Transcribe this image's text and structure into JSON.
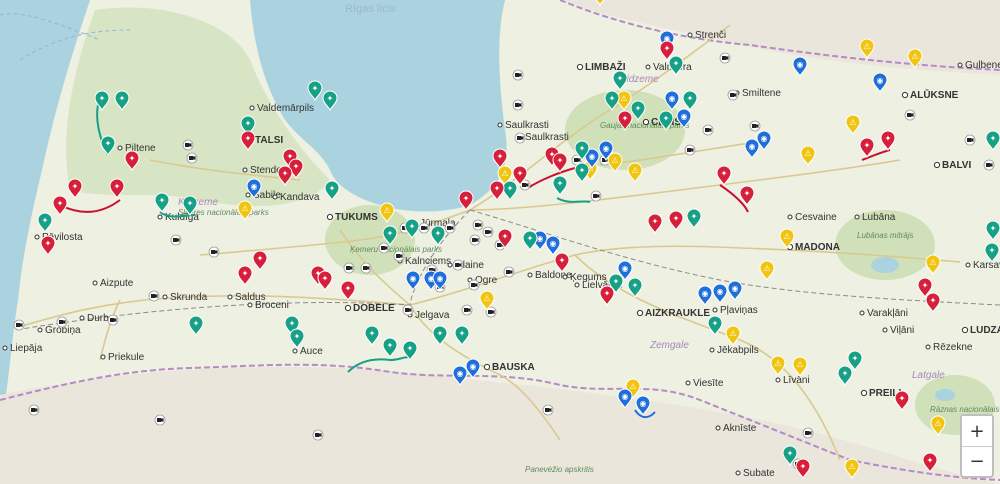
{
  "map": {
    "sea_label": "Rīgas līcis",
    "region_labels": [
      "Kurzeme",
      "Vidzeme",
      "Zemgale",
      "Latgale"
    ],
    "park_labels": [
      "Gaujas nacionālais parks",
      "Ķemeru nacionālais parks",
      "Lubānas mitrājs",
      "Rāznas nacionālais parks",
      "Slīteres nacionālais parks"
    ],
    "neighbor_labels": [
      "Panevėžio apskritis"
    ],
    "places": [
      {
        "name": "LIMBAŽI",
        "major": true
      },
      {
        "name": "Valmiera",
        "major": false
      },
      {
        "name": "Strenči",
        "major": false
      },
      {
        "name": "Smiltene",
        "major": false
      },
      {
        "name": "ALŪKSNE",
        "major": true
      },
      {
        "name": "Valdemārpils",
        "major": false
      },
      {
        "name": "TALSI",
        "major": true
      },
      {
        "name": "Saulkrasti",
        "major": false
      },
      {
        "name": "CĒSIS",
        "major": true
      },
      {
        "name": "Piltene",
        "major": false
      },
      {
        "name": "Stende",
        "major": false
      },
      {
        "name": "Sabile",
        "major": false
      },
      {
        "name": "Kandava",
        "major": false
      },
      {
        "name": "TUKUMS",
        "major": true
      },
      {
        "name": "Jūrmala",
        "major": false
      },
      {
        "name": "BALVI",
        "major": true
      },
      {
        "name": "Cesvaine",
        "major": false
      },
      {
        "name": "Lubāna",
        "major": false
      },
      {
        "name": "MADONA",
        "major": true
      },
      {
        "name": "Pāvilosta",
        "major": false
      },
      {
        "name": "Kalnciems",
        "major": false
      },
      {
        "name": "Olaine",
        "major": false
      },
      {
        "name": "Baldone",
        "major": false
      },
      {
        "name": "Ķegums",
        "major": false
      },
      {
        "name": "Lielvārde",
        "major": false
      },
      {
        "name": "Aizpute",
        "major": false
      },
      {
        "name": "Skrunda",
        "major": false
      },
      {
        "name": "Broceni",
        "major": false
      },
      {
        "name": "DOBELE",
        "major": true
      },
      {
        "name": "AIZKRAUKLE",
        "major": true
      },
      {
        "name": "Varakļāni",
        "major": false
      },
      {
        "name": "Viļāni",
        "major": false
      },
      {
        "name": "LUDZA",
        "major": true
      },
      {
        "name": "Durbe",
        "major": false
      },
      {
        "name": "Grobiņa",
        "major": false
      },
      {
        "name": "Liepāja",
        "major": false
      },
      {
        "name": "Priekule",
        "major": false
      },
      {
        "name": "Auce",
        "major": false
      },
      {
        "name": "BAUSKA",
        "major": true
      },
      {
        "name": "Jēkabpils",
        "major": false
      },
      {
        "name": "Viesīte",
        "major": false
      },
      {
        "name": "Līvāni",
        "major": false
      },
      {
        "name": "PREIĻI",
        "major": true
      },
      {
        "name": "Rēzekne",
        "major": false
      },
      {
        "name": "Aknīste",
        "major": false
      },
      {
        "name": "Subate",
        "major": false
      },
      {
        "name": "Jelgava",
        "major": false
      },
      {
        "name": "Ogre",
        "major": false
      },
      {
        "name": "Saulkrasti",
        "major": false
      },
      {
        "name": "Kuldīga",
        "major": false
      },
      {
        "name": "Saldus",
        "major": false
      },
      {
        "name": "Karsava",
        "major": false
      },
      {
        "name": "Pļaviņas",
        "major": false
      },
      {
        "name": "Gulbene",
        "major": false
      }
    ],
    "markers": {
      "cyclist_green": 42,
      "cyclist_red": 36,
      "speed_camera_blue": 24,
      "roadwork_yellow": 22,
      "camera_white": 48
    }
  },
  "zoom": {
    "in": "+",
    "out": "−"
  }
}
